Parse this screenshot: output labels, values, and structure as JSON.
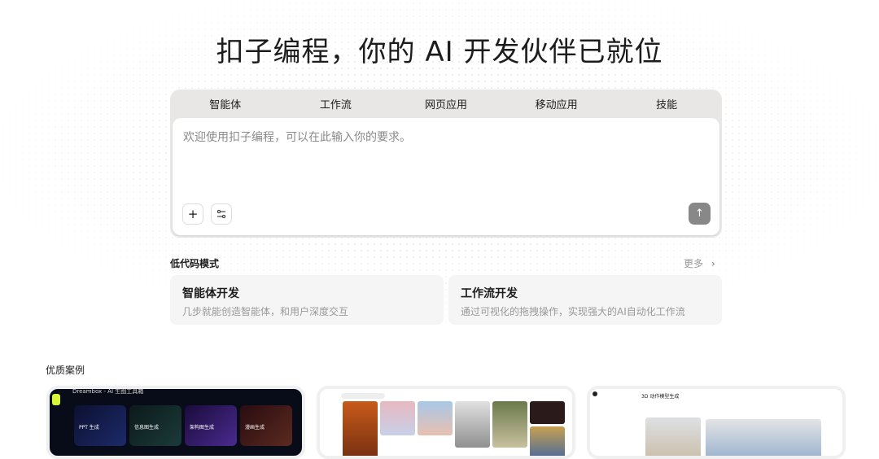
{
  "headline": "扣子编程，你的 AI 开发伙伴已就位",
  "tabs": [
    "智能体",
    "工作流",
    "网页应用",
    "移动应用",
    "技能"
  ],
  "input": {
    "placeholder": "欢迎使用扣子编程，可以在此输入你的要求。"
  },
  "buttons": {
    "add": "+",
    "send": "↑"
  },
  "lowcode": {
    "title": "低代码模式",
    "more": "更多",
    "cards": [
      {
        "title": "智能体开发",
        "desc": "几步就能创造智能体，和用户深度交互"
      },
      {
        "title": "工作流开发",
        "desc": "通过可视化的拖拽操作，实现强大的AI自动化工作流"
      }
    ]
  },
  "cases": {
    "title": "优质案例",
    "case1": {
      "title": "Dreambox - AI 生图工具箱",
      "tools": [
        "PPT 生成",
        "信息图生成",
        "架构图生成",
        "漫画生成"
      ]
    },
    "case3": {
      "title": "3D 动作模型生成"
    }
  }
}
